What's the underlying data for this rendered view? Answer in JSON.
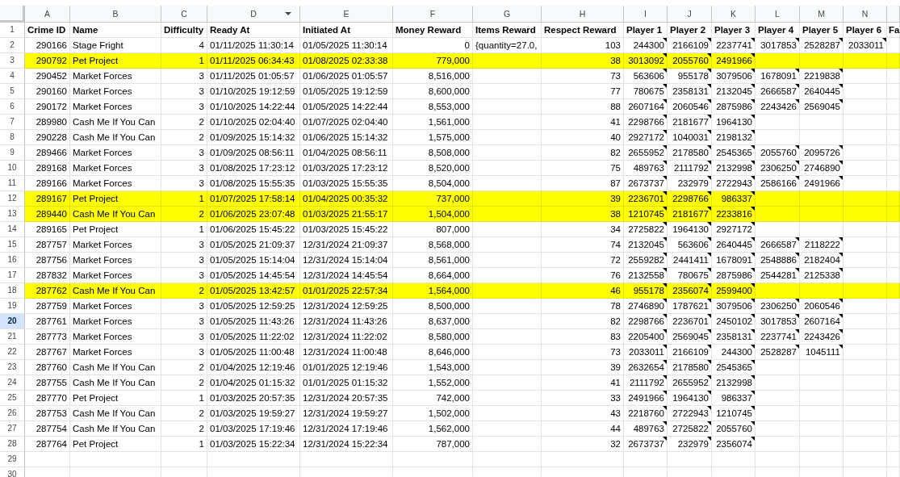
{
  "columns": [
    {
      "letter": "A",
      "menu_arrow": false
    },
    {
      "letter": "B",
      "menu_arrow": false
    },
    {
      "letter": "C",
      "menu_arrow": false
    },
    {
      "letter": "D",
      "menu_arrow": true
    },
    {
      "letter": "E",
      "menu_arrow": false
    },
    {
      "letter": "F",
      "menu_arrow": false
    },
    {
      "letter": "G",
      "menu_arrow": false
    },
    {
      "letter": "H",
      "menu_arrow": false
    },
    {
      "letter": "I",
      "menu_arrow": false
    },
    {
      "letter": "J",
      "menu_arrow": false
    },
    {
      "letter": "K",
      "menu_arrow": false
    },
    {
      "letter": "L",
      "menu_arrow": false
    },
    {
      "letter": "M",
      "menu_arrow": false
    },
    {
      "letter": "N",
      "menu_arrow": false
    }
  ],
  "header_row": {
    "number": "1",
    "selected": false,
    "cells": [
      "Crime ID",
      "Name",
      "Difficulty",
      "Ready At",
      "Initiated At",
      "Money Reward",
      "Items Reward",
      "Respect Reward",
      "Player 1",
      "Player 2",
      "Player 3",
      "Player 4",
      "Player 5",
      "Player 6",
      "Fa"
    ]
  },
  "rows": [
    {
      "number": "2",
      "selected": false,
      "highlighted": false,
      "crime_id": "290166",
      "name": "Stage Fright",
      "difficulty": "4",
      "ready_at": "01/11/2025 11:30:14",
      "initiated_at": "01/05/2025 11:30:14",
      "money_reward": "0",
      "items_reward": "{quantity=27.0,",
      "respect_reward": "103",
      "players": [
        {
          "id": "244300",
          "note": true
        },
        {
          "id": "2166109",
          "note": true
        },
        {
          "id": "2237741",
          "note": true
        },
        {
          "id": "3017853",
          "note": true
        },
        {
          "id": "2528287",
          "note": true
        },
        {
          "id": "2033011",
          "note": true
        }
      ]
    },
    {
      "number": "3",
      "selected": false,
      "highlighted": true,
      "crime_id": "290792",
      "name": "Pet Project",
      "difficulty": "1",
      "ready_at": "01/11/2025 06:34:43",
      "initiated_at": "01/08/2025 02:33:38",
      "money_reward": "779,000",
      "respect_reward": "38",
      "players": [
        {
          "id": "3013092",
          "note": true
        },
        {
          "id": "2055760",
          "note": true
        },
        {
          "id": "2491966",
          "note": true
        }
      ]
    },
    {
      "number": "4",
      "selected": false,
      "highlighted": false,
      "crime_id": "290452",
      "name": "Market Forces",
      "difficulty": "3",
      "ready_at": "01/11/2025 01:05:57",
      "initiated_at": "01/06/2025 01:05:57",
      "money_reward": "8,516,000",
      "respect_reward": "73",
      "players": [
        {
          "id": "563606",
          "note": true
        },
        {
          "id": "955178",
          "note": true
        },
        {
          "id": "3079506",
          "note": true
        },
        {
          "id": "1678091",
          "note": true
        },
        {
          "id": "2219838",
          "note": true
        }
      ]
    },
    {
      "number": "5",
      "selected": false,
      "highlighted": false,
      "crime_id": "290160",
      "name": "Market Forces",
      "difficulty": "3",
      "ready_at": "01/10/2025 19:12:59",
      "initiated_at": "01/05/2025 19:12:59",
      "money_reward": "8,600,000",
      "respect_reward": "77",
      "players": [
        {
          "id": "780675",
          "note": true
        },
        {
          "id": "2358131",
          "note": true
        },
        {
          "id": "2132045",
          "note": true
        },
        {
          "id": "2666587",
          "note": true
        },
        {
          "id": "2640445",
          "note": true
        }
      ]
    },
    {
      "number": "6",
      "selected": false,
      "highlighted": false,
      "crime_id": "290172",
      "name": "Market Forces",
      "difficulty": "3",
      "ready_at": "01/10/2025 14:22:44",
      "initiated_at": "01/05/2025 14:22:44",
      "money_reward": "8,553,000",
      "respect_reward": "88",
      "players": [
        {
          "id": "2607164",
          "note": true
        },
        {
          "id": "2060546",
          "note": true
        },
        {
          "id": "2875986",
          "note": true
        },
        {
          "id": "2243426",
          "note": true
        },
        {
          "id": "2569045",
          "note": true
        }
      ]
    },
    {
      "number": "7",
      "selected": false,
      "highlighted": false,
      "crime_id": "289980",
      "name": "Cash Me If You Can",
      "difficulty": "2",
      "ready_at": "01/10/2025 02:04:40",
      "initiated_at": "01/07/2025 02:04:40",
      "money_reward": "1,561,000",
      "respect_reward": "41",
      "players": [
        {
          "id": "2298766",
          "note": true
        },
        {
          "id": "2181677",
          "note": true
        },
        {
          "id": "1964130",
          "note": true
        }
      ]
    },
    {
      "number": "8",
      "selected": false,
      "highlighted": false,
      "crime_id": "290228",
      "name": "Cash Me If You Can",
      "difficulty": "2",
      "ready_at": "01/09/2025 15:14:32",
      "initiated_at": "01/06/2025 15:14:32",
      "money_reward": "1,575,000",
      "respect_reward": "40",
      "players": [
        {
          "id": "2927172",
          "note": true
        },
        {
          "id": "1040031",
          "note": true
        },
        {
          "id": "2198132",
          "note": true
        }
      ]
    },
    {
      "number": "9",
      "selected": false,
      "highlighted": false,
      "crime_id": "289466",
      "name": "Market Forces",
      "difficulty": "3",
      "ready_at": "01/09/2025 08:56:11",
      "initiated_at": "01/04/2025 08:56:11",
      "money_reward": "8,508,000",
      "respect_reward": "82",
      "players": [
        {
          "id": "2655952",
          "note": true
        },
        {
          "id": "2178580",
          "note": true
        },
        {
          "id": "2545365",
          "note": true
        },
        {
          "id": "2055760",
          "note": true
        },
        {
          "id": "2095726",
          "note": true
        }
      ]
    },
    {
      "number": "10",
      "selected": false,
      "highlighted": false,
      "crime_id": "289168",
      "name": "Market Forces",
      "difficulty": "3",
      "ready_at": "01/08/2025 17:23:12",
      "initiated_at": "01/03/2025 17:23:12",
      "money_reward": "8,520,000",
      "respect_reward": "75",
      "players": [
        {
          "id": "489763",
          "note": true
        },
        {
          "id": "2111792",
          "note": true
        },
        {
          "id": "2132998",
          "note": true
        },
        {
          "id": "2306250",
          "note": true
        },
        {
          "id": "2746890",
          "note": true
        }
      ]
    },
    {
      "number": "11",
      "selected": false,
      "highlighted": false,
      "crime_id": "289166",
      "name": "Market Forces",
      "difficulty": "3",
      "ready_at": "01/08/2025 15:55:35",
      "initiated_at": "01/03/2025 15:55:35",
      "money_reward": "8,504,000",
      "respect_reward": "87",
      "players": [
        {
          "id": "2673737",
          "note": true
        },
        {
          "id": "232979",
          "note": true
        },
        {
          "id": "2722943",
          "note": true
        },
        {
          "id": "2586166",
          "note": true
        },
        {
          "id": "2491966",
          "note": true
        }
      ]
    },
    {
      "number": "12",
      "selected": false,
      "highlighted": true,
      "crime_id": "289167",
      "name": "Pet Project",
      "difficulty": "1",
      "ready_at": "01/07/2025 17:58:14",
      "initiated_at": "01/04/2025 00:35:32",
      "money_reward": "737,000",
      "respect_reward": "39",
      "players": [
        {
          "id": "2236701",
          "note": true
        },
        {
          "id": "2298766",
          "note": true
        },
        {
          "id": "986337",
          "note": true
        }
      ]
    },
    {
      "number": "13",
      "selected": false,
      "highlighted": true,
      "crime_id": "289440",
      "name": "Cash Me If You Can",
      "difficulty": "2",
      "ready_at": "01/06/2025 23:07:48",
      "initiated_at": "01/03/2025 21:55:17",
      "money_reward": "1,504,000",
      "respect_reward": "38",
      "players": [
        {
          "id": "1210745",
          "note": true
        },
        {
          "id": "2181677",
          "note": true
        },
        {
          "id": "2233816",
          "note": true
        }
      ]
    },
    {
      "number": "14",
      "selected": false,
      "highlighted": false,
      "crime_id": "289165",
      "name": "Pet Project",
      "difficulty": "1",
      "ready_at": "01/06/2025 15:45:22",
      "initiated_at": "01/03/2025 15:45:22",
      "money_reward": "807,000",
      "respect_reward": "34",
      "players": [
        {
          "id": "2725822",
          "note": true
        },
        {
          "id": "1964130",
          "note": true
        },
        {
          "id": "2927172",
          "note": true
        }
      ]
    },
    {
      "number": "15",
      "selected": false,
      "highlighted": false,
      "crime_id": "287757",
      "name": "Market Forces",
      "difficulty": "3",
      "ready_at": "01/05/2025 21:09:37",
      "initiated_at": "12/31/2024 21:09:37",
      "money_reward": "8,568,000",
      "respect_reward": "74",
      "players": [
        {
          "id": "2132045",
          "note": true
        },
        {
          "id": "563606",
          "note": true
        },
        {
          "id": "2640445",
          "note": true
        },
        {
          "id": "2666587",
          "note": true
        },
        {
          "id": "2118222",
          "note": true
        }
      ]
    },
    {
      "number": "16",
      "selected": false,
      "highlighted": false,
      "crime_id": "287756",
      "name": "Market Forces",
      "difficulty": "3",
      "ready_at": "01/05/2025 15:14:04",
      "initiated_at": "12/31/2024 15:14:04",
      "money_reward": "8,561,000",
      "respect_reward": "72",
      "players": [
        {
          "id": "2559282",
          "note": true
        },
        {
          "id": "2441411",
          "note": true
        },
        {
          "id": "1678091",
          "note": true
        },
        {
          "id": "2548886",
          "note": true
        },
        {
          "id": "2182404",
          "note": true
        }
      ]
    },
    {
      "number": "17",
      "selected": false,
      "highlighted": false,
      "crime_id": "287832",
      "name": "Market Forces",
      "difficulty": "3",
      "ready_at": "01/05/2025 14:45:54",
      "initiated_at": "12/31/2024 14:45:54",
      "money_reward": "8,664,000",
      "respect_reward": "76",
      "players": [
        {
          "id": "2132558",
          "note": true
        },
        {
          "id": "780675",
          "note": true
        },
        {
          "id": "2875986",
          "note": true
        },
        {
          "id": "2544281",
          "note": true
        },
        {
          "id": "2125338",
          "note": true
        }
      ]
    },
    {
      "number": "18",
      "selected": false,
      "highlighted": true,
      "crime_id": "287762",
      "name": "Cash Me If You Can",
      "difficulty": "2",
      "ready_at": "01/05/2025 13:42:57",
      "initiated_at": "01/01/2025 22:57:34",
      "money_reward": "1,564,000",
      "respect_reward": "46",
      "players": [
        {
          "id": "955178",
          "note": true
        },
        {
          "id": "2356074",
          "note": true
        },
        {
          "id": "2599400",
          "note": true
        }
      ]
    },
    {
      "number": "19",
      "selected": false,
      "highlighted": false,
      "crime_id": "287759",
      "name": "Market Forces",
      "difficulty": "3",
      "ready_at": "01/05/2025 12:59:25",
      "initiated_at": "12/31/2024 12:59:25",
      "money_reward": "8,500,000",
      "respect_reward": "78",
      "players": [
        {
          "id": "2746890",
          "note": true
        },
        {
          "id": "1787621",
          "note": true
        },
        {
          "id": "3079506",
          "note": true
        },
        {
          "id": "2306250",
          "note": true
        },
        {
          "id": "2060546",
          "note": true
        }
      ]
    },
    {
      "number": "20",
      "selected": true,
      "highlighted": false,
      "crime_id": "287761",
      "name": "Market Forces",
      "difficulty": "3",
      "ready_at": "01/05/2025 11:43:26",
      "initiated_at": "12/31/2024 11:43:26",
      "money_reward": "8,637,000",
      "respect_reward": "82",
      "players": [
        {
          "id": "2298766",
          "note": true
        },
        {
          "id": "2236701",
          "note": true
        },
        {
          "id": "2450102",
          "note": true
        },
        {
          "id": "3017853",
          "note": true
        },
        {
          "id": "2607164",
          "note": true
        }
      ]
    },
    {
      "number": "21",
      "selected": false,
      "highlighted": false,
      "crime_id": "287773",
      "name": "Market Forces",
      "difficulty": "3",
      "ready_at": "01/05/2025 11:22:02",
      "initiated_at": "12/31/2024 11:22:02",
      "money_reward": "8,580,000",
      "respect_reward": "83",
      "players": [
        {
          "id": "2205400",
          "note": true
        },
        {
          "id": "2569045",
          "note": true
        },
        {
          "id": "2358131",
          "note": true
        },
        {
          "id": "2237741",
          "note": true
        },
        {
          "id": "2243426",
          "note": true
        }
      ]
    },
    {
      "number": "22",
      "selected": false,
      "highlighted": false,
      "crime_id": "287767",
      "name": "Market Forces",
      "difficulty": "3",
      "ready_at": "01/05/2025 11:00:48",
      "initiated_at": "12/31/2024 11:00:48",
      "money_reward": "8,646,000",
      "respect_reward": "73",
      "players": [
        {
          "id": "2033011",
          "note": true
        },
        {
          "id": "2166109",
          "note": true
        },
        {
          "id": "244300",
          "note": true
        },
        {
          "id": "2528287",
          "note": true
        },
        {
          "id": "1045111",
          "note": true
        }
      ]
    },
    {
      "number": "23",
      "selected": false,
      "highlighted": false,
      "crime_id": "287760",
      "name": "Cash Me If You Can",
      "difficulty": "2",
      "ready_at": "01/04/2025 12:19:46",
      "initiated_at": "01/01/2025 12:19:46",
      "money_reward": "1,543,000",
      "respect_reward": "39",
      "players": [
        {
          "id": "2632654",
          "note": true
        },
        {
          "id": "2178580",
          "note": true
        },
        {
          "id": "2545365",
          "note": true
        }
      ]
    },
    {
      "number": "24",
      "selected": false,
      "highlighted": false,
      "crime_id": "287755",
      "name": "Cash Me If You Can",
      "difficulty": "2",
      "ready_at": "01/04/2025 01:15:32",
      "initiated_at": "01/01/2025 01:15:32",
      "money_reward": "1,552,000",
      "respect_reward": "41",
      "players": [
        {
          "id": "2111792",
          "note": true
        },
        {
          "id": "2655952",
          "note": true
        },
        {
          "id": "2132998",
          "note": true
        }
      ]
    },
    {
      "number": "25",
      "selected": false,
      "highlighted": false,
      "crime_id": "287770",
      "name": "Pet Project",
      "difficulty": "1",
      "ready_at": "01/03/2025 20:57:35",
      "initiated_at": "12/31/2024 20:57:35",
      "money_reward": "742,000",
      "respect_reward": "33",
      "players": [
        {
          "id": "2491966",
          "note": true
        },
        {
          "id": "1964130",
          "note": true
        },
        {
          "id": "986337",
          "note": true
        }
      ]
    },
    {
      "number": "26",
      "selected": false,
      "highlighted": false,
      "crime_id": "287753",
      "name": "Cash Me If You Can",
      "difficulty": "2",
      "ready_at": "01/03/2025 19:59:27",
      "initiated_at": "12/31/2024 19:59:27",
      "money_reward": "1,502,000",
      "respect_reward": "43",
      "players": [
        {
          "id": "2218760",
          "note": true
        },
        {
          "id": "2722943",
          "note": true
        },
        {
          "id": "1210745",
          "note": true
        }
      ]
    },
    {
      "number": "27",
      "selected": false,
      "highlighted": false,
      "crime_id": "287754",
      "name": "Cash Me If You Can",
      "difficulty": "2",
      "ready_at": "01/03/2025 17:19:46",
      "initiated_at": "12/31/2024 17:19:46",
      "money_reward": "1,562,000",
      "respect_reward": "44",
      "players": [
        {
          "id": "489763",
          "note": true
        },
        {
          "id": "2725822",
          "note": true
        },
        {
          "id": "2055760",
          "note": true
        }
      ]
    },
    {
      "number": "28",
      "selected": false,
      "highlighted": false,
      "crime_id": "287764",
      "name": "Pet Project",
      "difficulty": "1",
      "ready_at": "01/03/2025 15:22:34",
      "initiated_at": "12/31/2024 15:22:34",
      "money_reward": "787,000",
      "respect_reward": "32",
      "players": [
        {
          "id": "2673737",
          "note": true
        },
        {
          "id": "232979",
          "note": true
        },
        {
          "id": "2356074",
          "note": true
        }
      ]
    }
  ],
  "empty_rows": [
    {
      "number": "29",
      "selected": false
    },
    {
      "number": "30",
      "selected": false
    }
  ]
}
